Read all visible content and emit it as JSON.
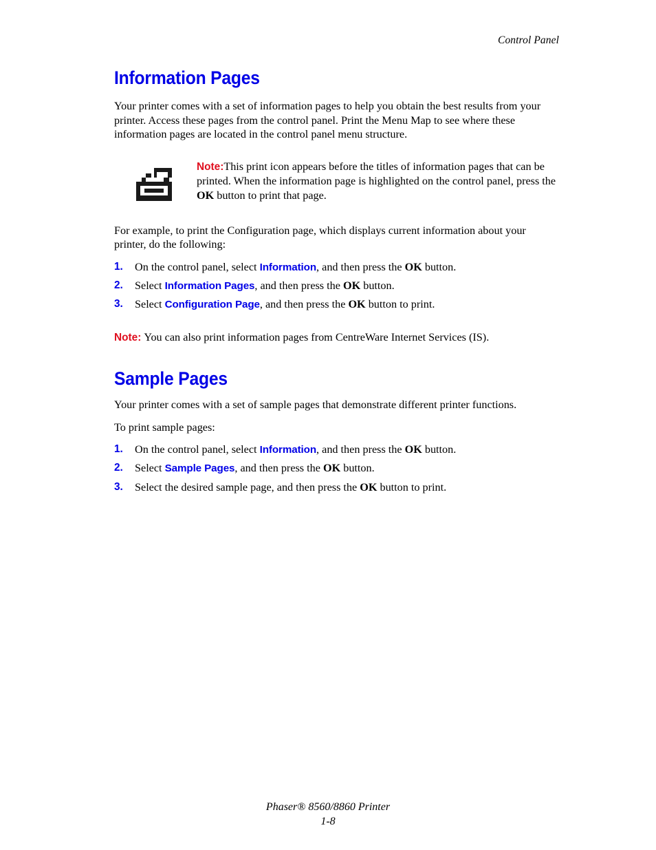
{
  "header": {
    "running_head": "Control Panel"
  },
  "colors": {
    "heading_blue": "#0000e6",
    "note_red": "#e01020",
    "body_black": "#000000"
  },
  "sections": [
    {
      "id": "information-pages",
      "heading": "Information Pages",
      "intro": "Your printer comes with a set of information pages to help you obtain the best results from your printer. Access these pages from the control panel. Print the Menu Map to see where these information pages are located in the control panel menu structure.",
      "note_box": {
        "icon": "printer-icon",
        "label": "Note:",
        "text_part_1": "This print icon appears before the titles of information pages that can be printed. When the information page is highlighted on the control panel, press the ",
        "button": "OK",
        "text_part_2": " button to print that page."
      },
      "lead_in": "For example, to print the Configuration page, which displays current information about your printer, do the following:",
      "steps": [
        {
          "number": "1.",
          "text_before": "On the control panel, select ",
          "ui_term": "Information",
          "text_middle": ", and then press the ",
          "button": "OK",
          "text_after": " button."
        },
        {
          "number": "2.",
          "text_before": "Select ",
          "ui_term": "Information Pages",
          "text_middle": ", and then press the ",
          "button": "OK",
          "text_after": " button."
        },
        {
          "number": "3.",
          "text_before": "Select ",
          "ui_term": "Configuration Page",
          "text_middle": ", and then press the ",
          "button": "OK",
          "text_after": " button to print."
        }
      ],
      "trailing_note": {
        "label": "Note:",
        "text": "You can also print information pages from CentreWare Internet Services (IS)."
      }
    },
    {
      "id": "sample-pages",
      "heading": "Sample Pages",
      "intro": "Your printer comes with a set of sample pages that demonstrate different printer functions.",
      "lead_in": "To print sample pages:",
      "steps": [
        {
          "number": "1.",
          "text_before": "On the control panel, select ",
          "ui_term": "Information",
          "text_middle": ", and then press the ",
          "button": "OK",
          "text_after": " button."
        },
        {
          "number": "2.",
          "text_before": "Select ",
          "ui_term": "Sample Pages",
          "text_middle": ", and then press the ",
          "button": "OK",
          "text_after": " button."
        },
        {
          "number": "3.",
          "text_before": "Select the desired sample page, and then press the ",
          "ui_term": "",
          "text_middle": "",
          "button": "OK",
          "text_after": " button to print."
        }
      ]
    }
  ],
  "footer": {
    "product": "Phaser® 8560/8860 Printer",
    "page_number": "1-8"
  }
}
